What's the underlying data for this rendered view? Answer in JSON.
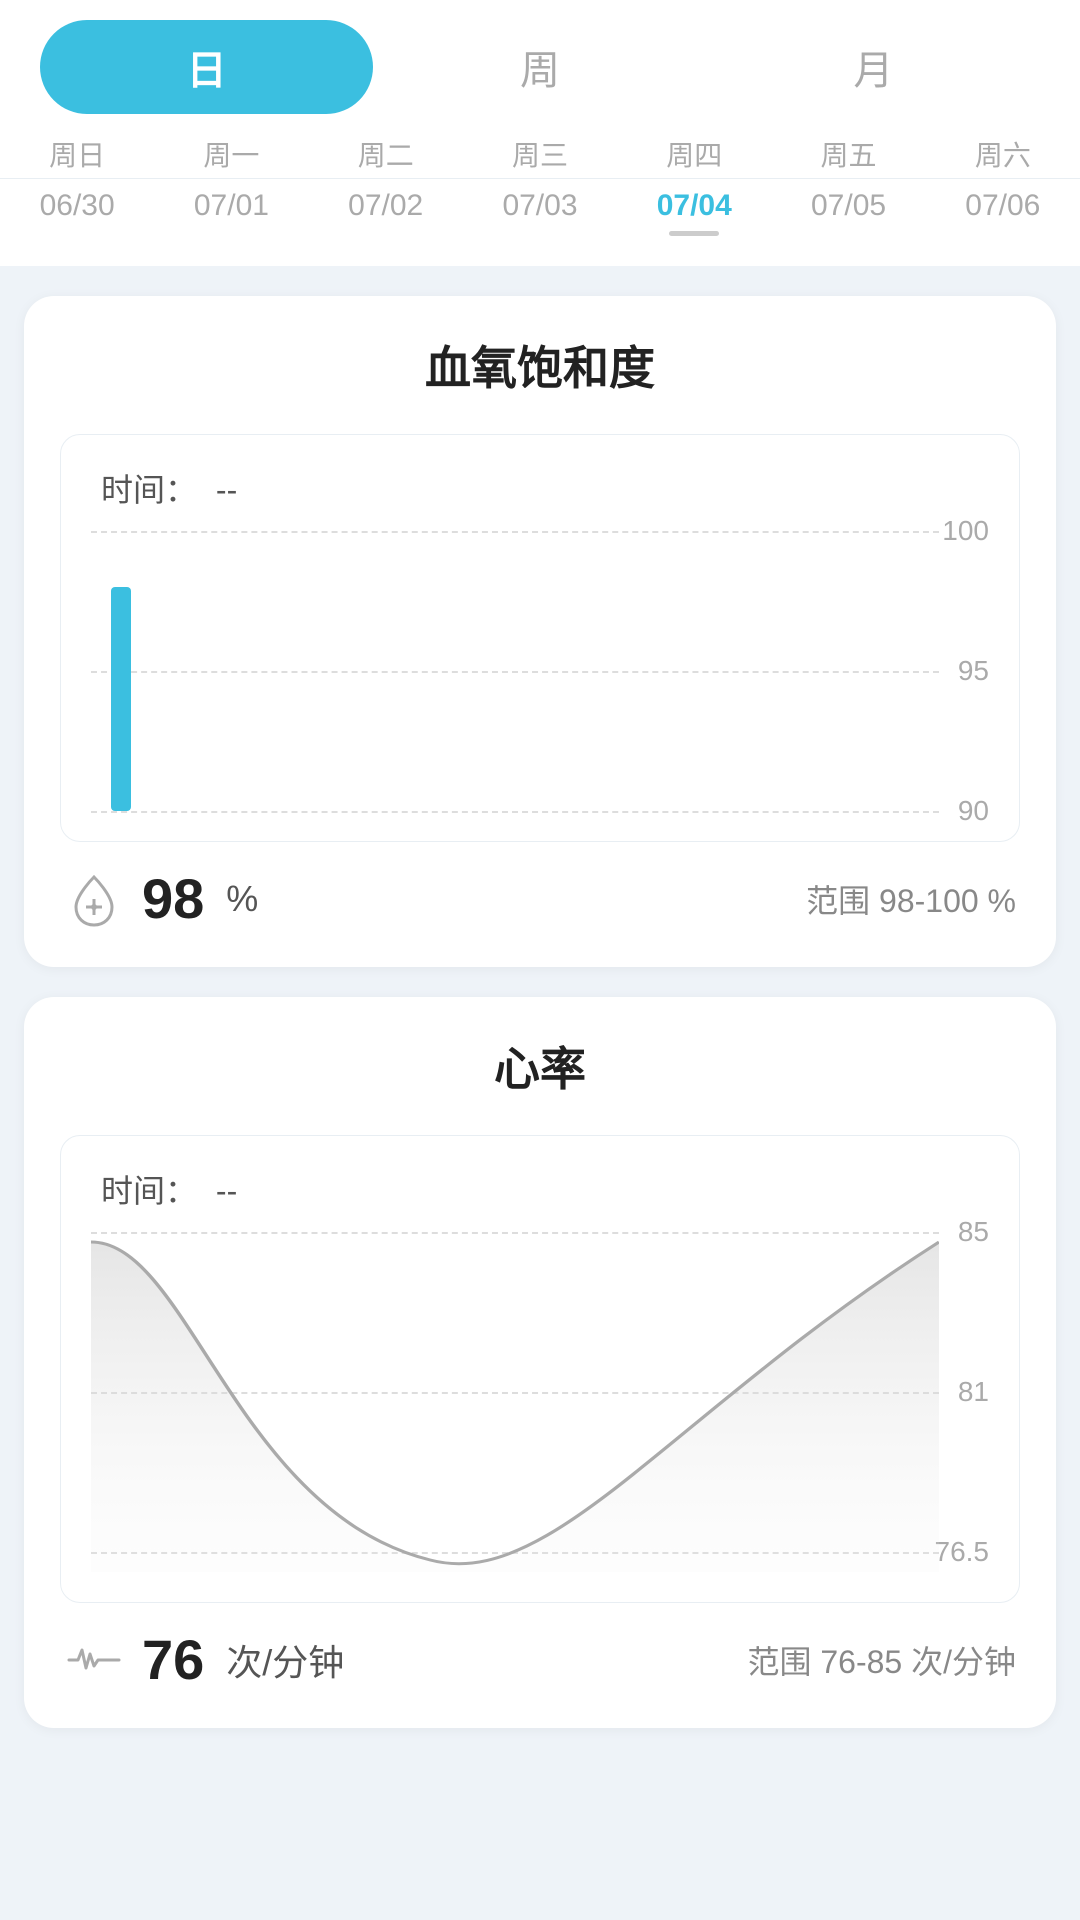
{
  "tabs": [
    {
      "id": "day",
      "label": "日",
      "active": true
    },
    {
      "id": "week",
      "label": "周",
      "active": false
    },
    {
      "id": "month",
      "label": "月",
      "active": false
    }
  ],
  "weekdays": [
    "周日",
    "周一",
    "周二",
    "周三",
    "周四",
    "周五",
    "周六"
  ],
  "dates": [
    {
      "value": "06/30",
      "active": false
    },
    {
      "value": "07/01",
      "active": false
    },
    {
      "value": "07/02",
      "active": false
    },
    {
      "value": "07/03",
      "active": false
    },
    {
      "value": "07/04",
      "active": true
    },
    {
      "value": "07/05",
      "active": false
    },
    {
      "value": "07/06",
      "active": false
    }
  ],
  "spo2": {
    "title": "血氧饱和度",
    "time_label": "时间：",
    "time_value": "--",
    "value": "98",
    "unit": "%",
    "range_label": "范围",
    "range_value": "98-100 %",
    "grid_max": "100",
    "grid_mid": "95",
    "grid_min": "90"
  },
  "heartrate": {
    "title": "心率",
    "time_label": "时间：",
    "time_value": "--",
    "value": "76",
    "unit": "次/分钟",
    "range_label": "范围",
    "range_value": "76-85 次/分钟",
    "grid_max": "85",
    "grid_mid": "81",
    "grid_min": "76.5"
  },
  "colors": {
    "active_tab": "#3bbfe0",
    "active_date": "#3bbfe0",
    "bar_color": "#3bbfe0"
  }
}
